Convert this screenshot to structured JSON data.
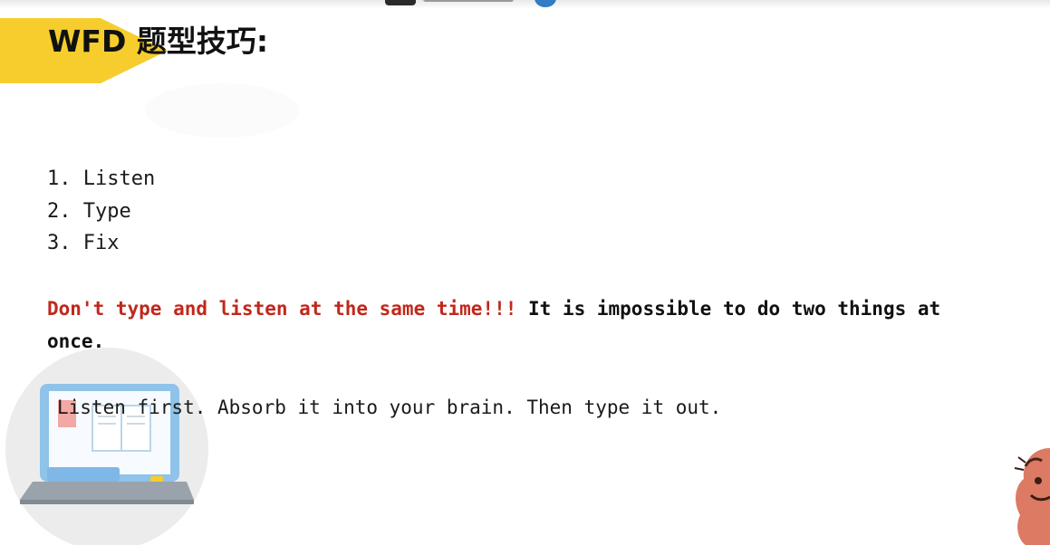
{
  "slide": {
    "title": "WFD 题型技巧:",
    "steps": [
      "1. Listen",
      "2. Type",
      "3. Fix"
    ],
    "warning_red": "Don't type and listen at the same time!!!",
    "warning_rest": " It is impossible to do two things at once.",
    "instruction": "Listen first. Absorb it into your brain. Then type it out."
  },
  "colors": {
    "title_band": "#f6cd2d",
    "warning_red": "#c0281c",
    "text": "#111111"
  },
  "icons": {
    "laptop": "laptop-illustration",
    "mascot": "mascot-character"
  }
}
